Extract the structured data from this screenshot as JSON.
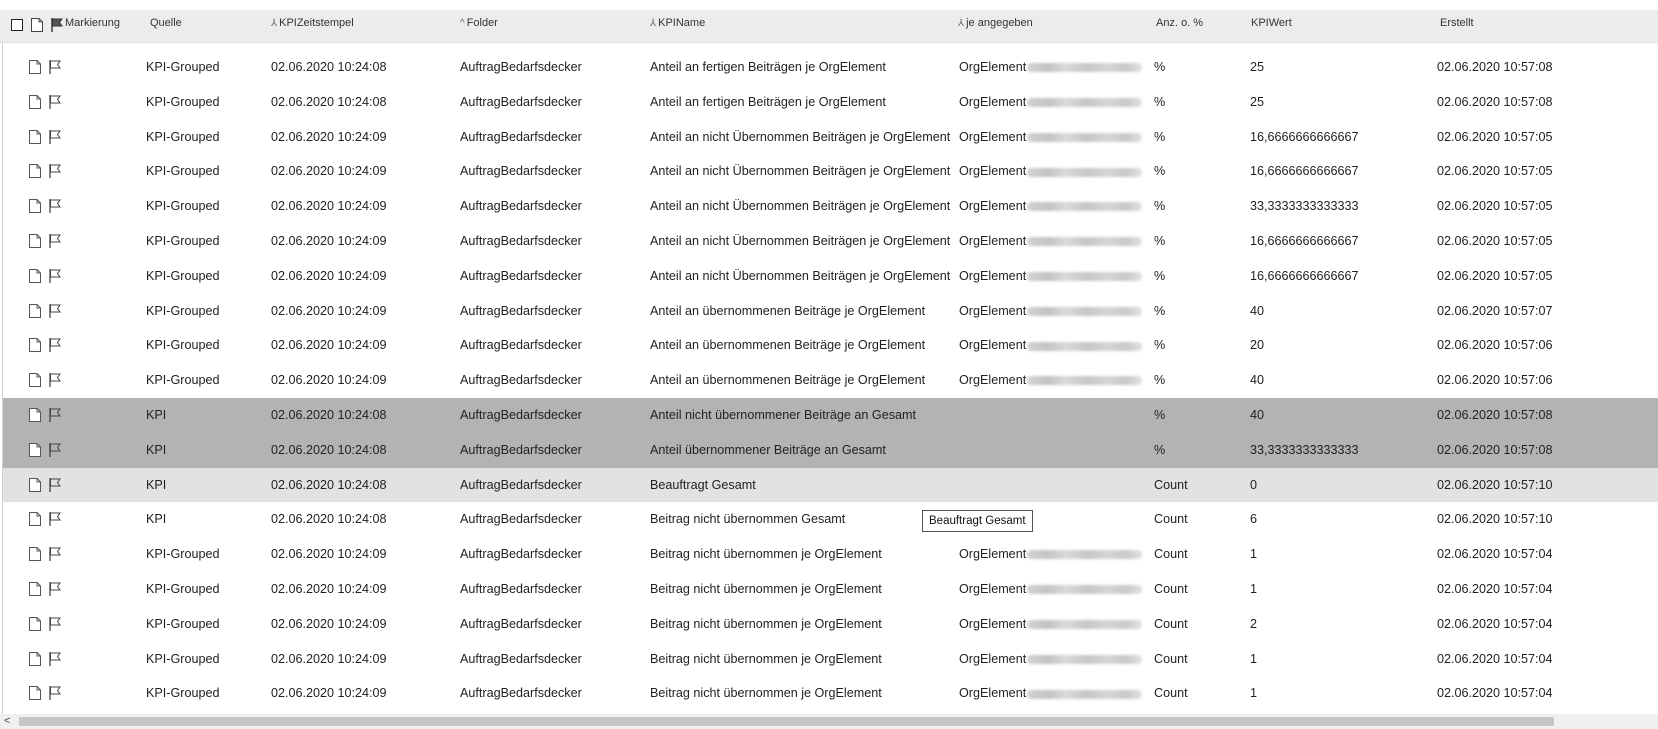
{
  "header": {
    "markierung": "Markierung",
    "quelle": "Quelle",
    "kpizeitstempel": "KPIZeitstempel",
    "folder": "Folder",
    "kpiname": "KPIName",
    "je_angegeben": "je angegeben",
    "anz": "Anz. o. %",
    "kpiwert": "KPIWert",
    "erstellt": "Erstellt"
  },
  "rows": [
    {
      "quelle": "KPI-Grouped",
      "zeit": "02.06.2020 10:24:08",
      "folder": "AuftragBedarfsdecker",
      "name": "Anteil an fertigen Beiträgen je OrgElement",
      "je": "OrgElement",
      "anz": "%",
      "wert": "25",
      "erstellt": "02.06.2020 10:57:08",
      "state": ""
    },
    {
      "quelle": "KPI-Grouped",
      "zeit": "02.06.2020 10:24:08",
      "folder": "AuftragBedarfsdecker",
      "name": "Anteil an fertigen Beiträgen je OrgElement",
      "je": "OrgElement",
      "anz": "%",
      "wert": "25",
      "erstellt": "02.06.2020 10:57:08",
      "state": ""
    },
    {
      "quelle": "KPI-Grouped",
      "zeit": "02.06.2020 10:24:09",
      "folder": "AuftragBedarfsdecker",
      "name": "Anteil an nicht Übernommen Beiträgen je OrgElement",
      "je": "OrgElement",
      "anz": "%",
      "wert": "16,6666666666667",
      "erstellt": "02.06.2020 10:57:05",
      "state": ""
    },
    {
      "quelle": "KPI-Grouped",
      "zeit": "02.06.2020 10:24:09",
      "folder": "AuftragBedarfsdecker",
      "name": "Anteil an nicht Übernommen Beiträgen je OrgElement",
      "je": "OrgElement",
      "anz": "%",
      "wert": "16,6666666666667",
      "erstellt": "02.06.2020 10:57:05",
      "state": ""
    },
    {
      "quelle": "KPI-Grouped",
      "zeit": "02.06.2020 10:24:09",
      "folder": "AuftragBedarfsdecker",
      "name": "Anteil an nicht Übernommen Beiträgen je OrgElement",
      "je": "OrgElement",
      "anz": "%",
      "wert": "33,3333333333333",
      "erstellt": "02.06.2020 10:57:05",
      "state": ""
    },
    {
      "quelle": "KPI-Grouped",
      "zeit": "02.06.2020 10:24:09",
      "folder": "AuftragBedarfsdecker",
      "name": "Anteil an nicht Übernommen Beiträgen je OrgElement",
      "je": "OrgElement",
      "anz": "%",
      "wert": "16,6666666666667",
      "erstellt": "02.06.2020 10:57:05",
      "state": ""
    },
    {
      "quelle": "KPI-Grouped",
      "zeit": "02.06.2020 10:24:09",
      "folder": "AuftragBedarfsdecker",
      "name": "Anteil an nicht Übernommen Beiträgen je OrgElement",
      "je": "OrgElement",
      "anz": "%",
      "wert": "16,6666666666667",
      "erstellt": "02.06.2020 10:57:05",
      "state": ""
    },
    {
      "quelle": "KPI-Grouped",
      "zeit": "02.06.2020 10:24:09",
      "folder": "AuftragBedarfsdecker",
      "name": "Anteil an übernommenen Beiträge je OrgElement",
      "je": "OrgElement",
      "anz": "%",
      "wert": "40",
      "erstellt": "02.06.2020 10:57:07",
      "state": ""
    },
    {
      "quelle": "KPI-Grouped",
      "zeit": "02.06.2020 10:24:09",
      "folder": "AuftragBedarfsdecker",
      "name": "Anteil an übernommenen Beiträge je OrgElement",
      "je": "OrgElement",
      "anz": "%",
      "wert": "20",
      "erstellt": "02.06.2020 10:57:06",
      "state": ""
    },
    {
      "quelle": "KPI-Grouped",
      "zeit": "02.06.2020 10:24:09",
      "folder": "AuftragBedarfsdecker",
      "name": "Anteil an übernommenen Beiträge je OrgElement",
      "je": "OrgElement",
      "anz": "%",
      "wert": "40",
      "erstellt": "02.06.2020 10:57:06",
      "state": ""
    },
    {
      "quelle": "KPI",
      "zeit": "02.06.2020 10:24:08",
      "folder": "AuftragBedarfsdecker",
      "name": "Anteil nicht übernommener Beiträge an Gesamt",
      "je": "",
      "anz": "%",
      "wert": "40",
      "erstellt": "02.06.2020 10:57:08",
      "state": "selected"
    },
    {
      "quelle": "KPI",
      "zeit": "02.06.2020 10:24:08",
      "folder": "AuftragBedarfsdecker",
      "name": "Anteil übernommener Beiträge an Gesamt",
      "je": "",
      "anz": "%",
      "wert": "33,3333333333333",
      "erstellt": "02.06.2020 10:57:08",
      "state": "selected"
    },
    {
      "quelle": "KPI",
      "zeit": "02.06.2020 10:24:08",
      "folder": "AuftragBedarfsdecker",
      "name": "Beauftragt Gesamt",
      "je": "",
      "anz": "Count",
      "wert": "0",
      "erstellt": "02.06.2020 10:57:10",
      "state": "hover"
    },
    {
      "quelle": "KPI",
      "zeit": "02.06.2020 10:24:08",
      "folder": "AuftragBedarfsdecker",
      "name": "Beitrag nicht übernommen Gesamt",
      "je": "",
      "anz": "Count",
      "wert": "6",
      "erstellt": "02.06.2020 10:57:10",
      "state": ""
    },
    {
      "quelle": "KPI-Grouped",
      "zeit": "02.06.2020 10:24:09",
      "folder": "AuftragBedarfsdecker",
      "name": "Beitrag nicht übernommen je OrgElement",
      "je": "OrgElement",
      "anz": "Count",
      "wert": "1",
      "erstellt": "02.06.2020 10:57:04",
      "state": ""
    },
    {
      "quelle": "KPI-Grouped",
      "zeit": "02.06.2020 10:24:09",
      "folder": "AuftragBedarfsdecker",
      "name": "Beitrag nicht übernommen je OrgElement",
      "je": "OrgElement",
      "anz": "Count",
      "wert": "1",
      "erstellt": "02.06.2020 10:57:04",
      "state": ""
    },
    {
      "quelle": "KPI-Grouped",
      "zeit": "02.06.2020 10:24:09",
      "folder": "AuftragBedarfsdecker",
      "name": "Beitrag nicht übernommen je OrgElement",
      "je": "OrgElement",
      "anz": "Count",
      "wert": "2",
      "erstellt": "02.06.2020 10:57:04",
      "state": ""
    },
    {
      "quelle": "KPI-Grouped",
      "zeit": "02.06.2020 10:24:09",
      "folder": "AuftragBedarfsdecker",
      "name": "Beitrag nicht übernommen je OrgElement",
      "je": "OrgElement",
      "anz": "Count",
      "wert": "1",
      "erstellt": "02.06.2020 10:57:04",
      "state": ""
    },
    {
      "quelle": "KPI-Grouped",
      "zeit": "02.06.2020 10:24:09",
      "folder": "AuftragBedarfsdecker",
      "name": "Beitrag nicht übernommen je OrgElement",
      "je": "OrgElement",
      "anz": "Count",
      "wert": "1",
      "erstellt": "02.06.2020 10:57:04",
      "state": ""
    }
  ],
  "tooltip": "Beauftragt Gesamt",
  "icons": {
    "row_doc": "document-icon",
    "row_flag": "flag-icon",
    "header_flag": "flag-filled-icon",
    "sort": "sort-icon"
  },
  "colors": {
    "header_bg": "#ececec",
    "selected_row": "#b3b3b3",
    "hover_row": "#e2e2e2"
  }
}
